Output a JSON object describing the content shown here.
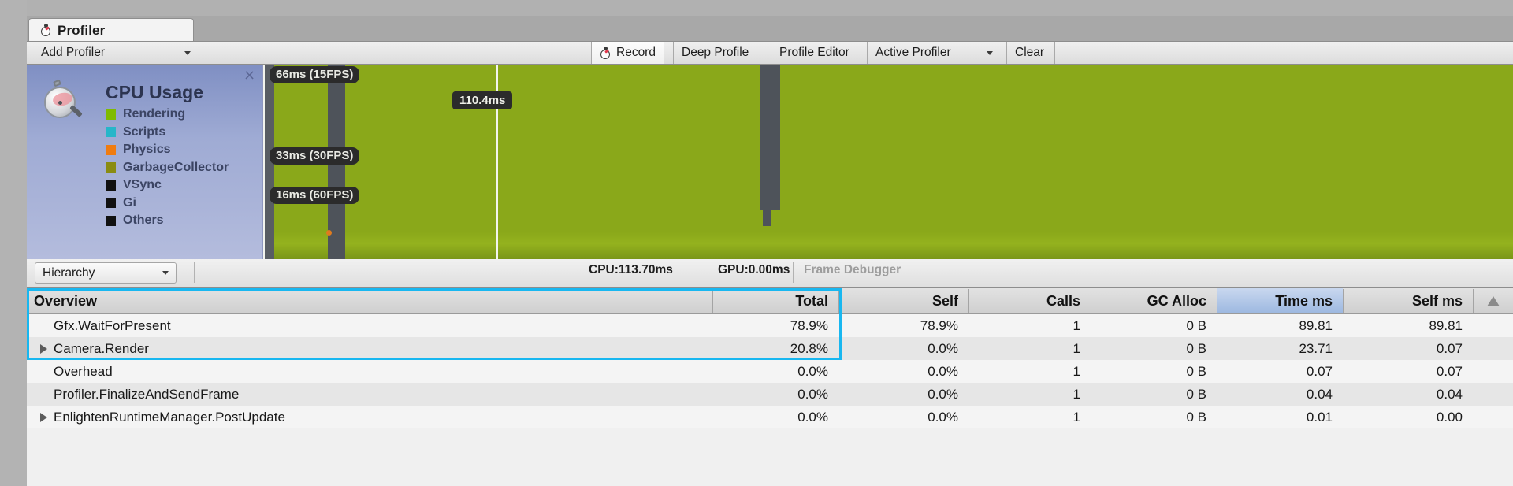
{
  "window": {
    "tab_label": "Profiler",
    "tab_icon": "stopwatch-icon"
  },
  "toolbar": {
    "add_profiler_label": "Add Profiler",
    "record_label": "Record",
    "deep_profile_label": "Deep Profile",
    "profile_editor_label": "Profile Editor",
    "active_profiler_label": "Active Profiler",
    "clear_label": "Clear"
  },
  "cpu_panel": {
    "title": "CPU Usage",
    "close_glyph": "×",
    "legend": [
      {
        "label": "Rendering",
        "color": "#7fbb00"
      },
      {
        "label": "Scripts",
        "color": "#26b6c9"
      },
      {
        "label": "Physics",
        "color": "#f07c10"
      },
      {
        "label": "GarbageCollector",
        "color": "#8a8c12"
      },
      {
        "label": "VSync",
        "color": "#111111"
      },
      {
        "label": "Gi",
        "color": "#111111"
      },
      {
        "label": "Others",
        "color": "#111111"
      }
    ]
  },
  "graph": {
    "threshold_labels": [
      {
        "text": "66ms (15FPS)"
      },
      {
        "text": "33ms (30FPS)"
      },
      {
        "text": "16ms (60FPS)"
      }
    ],
    "frame_tooltip": "110.4ms"
  },
  "hierarchy_bar": {
    "view_mode": "Hierarchy",
    "cpu_stat": "CPU:113.70ms",
    "gpu_stat": "GPU:0.00ms",
    "frame_debugger": "Frame Debugger"
  },
  "table": {
    "columns": [
      {
        "key": "overview",
        "label": "Overview"
      },
      {
        "key": "total",
        "label": "Total"
      },
      {
        "key": "self",
        "label": "Self"
      },
      {
        "key": "calls",
        "label": "Calls"
      },
      {
        "key": "gc_alloc",
        "label": "GC Alloc"
      },
      {
        "key": "time_ms",
        "label": "Time ms"
      },
      {
        "key": "self_ms",
        "label": "Self ms"
      }
    ],
    "sorted_column": "Time ms",
    "sort_indicator": "triangle-up-icon",
    "rows": [
      {
        "overview": "Gfx.WaitForPresent",
        "total": "78.9%",
        "self": "78.9%",
        "calls": "1",
        "gc_alloc": "0 B",
        "time_ms": "89.81",
        "self_ms": "89.81",
        "expandable": false
      },
      {
        "overview": "Camera.Render",
        "total": "20.8%",
        "self": "0.0%",
        "calls": "1",
        "gc_alloc": "0 B",
        "time_ms": "23.71",
        "self_ms": "0.07",
        "expandable": true
      },
      {
        "overview": "Overhead",
        "total": "0.0%",
        "self": "0.0%",
        "calls": "1",
        "gc_alloc": "0 B",
        "time_ms": "0.07",
        "self_ms": "0.07",
        "expandable": false
      },
      {
        "overview": "Profiler.FinalizeAndSendFrame",
        "total": "0.0%",
        "self": "0.0%",
        "calls": "1",
        "gc_alloc": "0 B",
        "time_ms": "0.04",
        "self_ms": "0.04",
        "expandable": false
      },
      {
        "overview": "EnlightenRuntimeManager.PostUpdate",
        "total": "0.0%",
        "self": "0.0%",
        "calls": "1",
        "gc_alloc": "0 B",
        "time_ms": "0.01",
        "self_ms": "0.00",
        "expandable": true
      }
    ]
  },
  "colors": {
    "selection_outline": "#18b7f0",
    "column_highlight": "#9cb8e0",
    "graph_green": "#8aa81a"
  }
}
